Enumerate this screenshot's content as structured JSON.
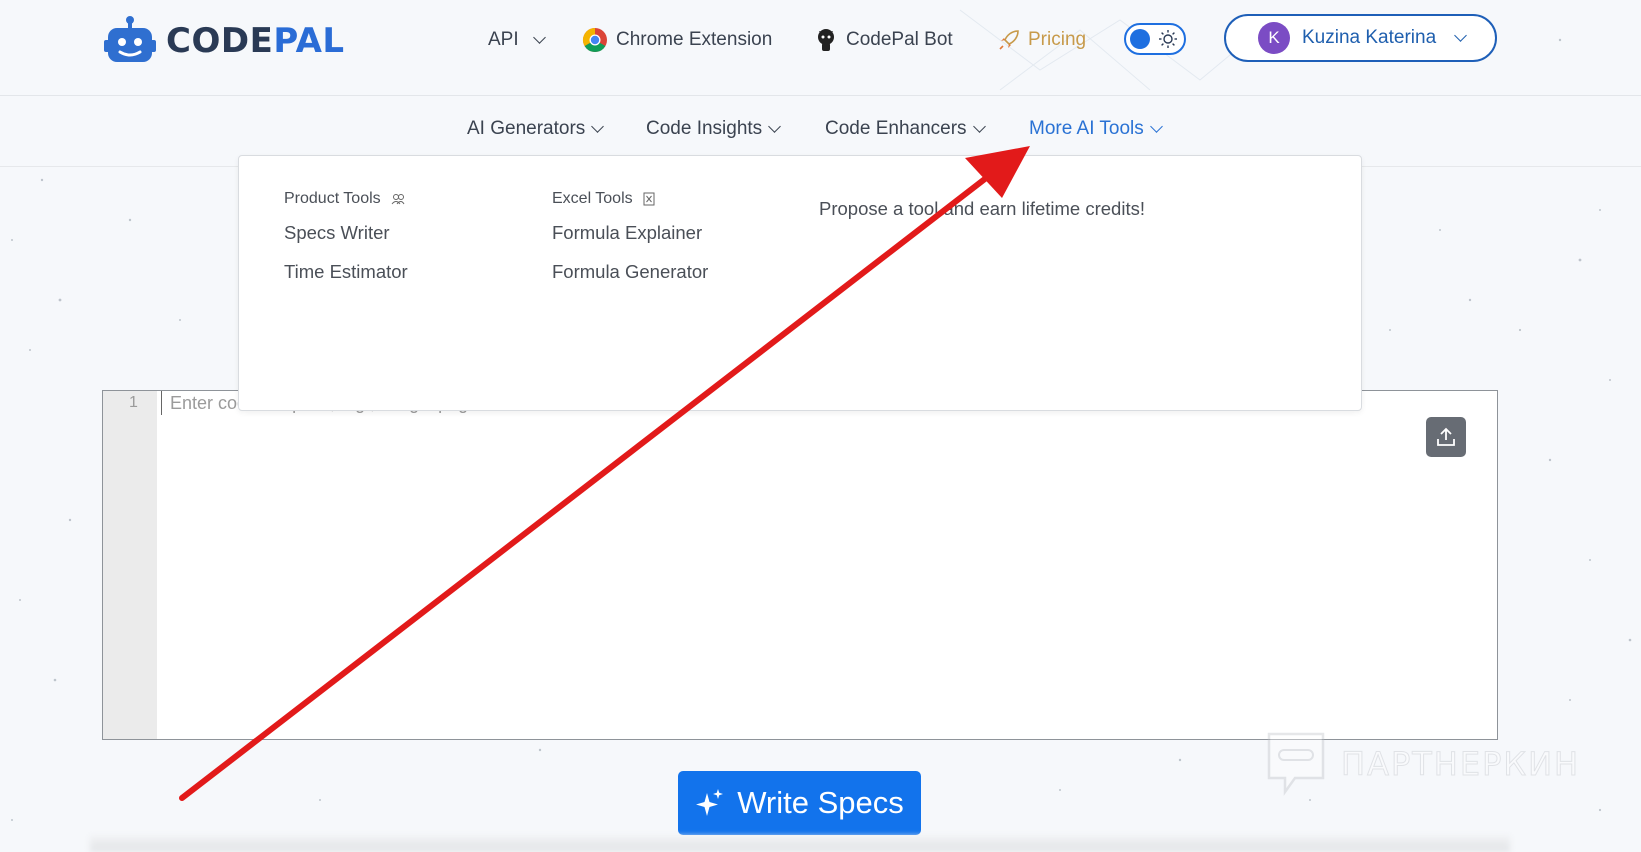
{
  "header": {
    "logo_part1": "CODE",
    "logo_part2": "PAL",
    "nav": {
      "api": "API",
      "chrome_extension": "Chrome Extension",
      "bot": "CodePal Bot",
      "pricing": "Pricing"
    },
    "user": {
      "initial": "K",
      "name": "Kuzina Katerina"
    }
  },
  "subnav": {
    "items": [
      "AI Generators",
      "Code Insights",
      "Code Enhancers",
      "More AI Tools"
    ],
    "active": "More AI Tools"
  },
  "dropdown": {
    "product_tools": {
      "title": "Product Tools",
      "links": [
        "Specs Writer",
        "Time Estimator"
      ]
    },
    "excel_tools": {
      "title": "Excel Tools",
      "links": [
        "Formula Explainer",
        "Formula Generator"
      ]
    },
    "cta": "Propose a tool and earn lifetime credits!"
  },
  "editor": {
    "line_number": "1",
    "placeholder": "Enter code or specs, e.g., a login page for users"
  },
  "action_button": "Write Specs",
  "watermark": "ПАРТНЕРКИН",
  "colors": {
    "accent": "#1273ec",
    "brand_dark": "#2a3a55",
    "brand_blue": "#2a6cd6",
    "pricing": "#c79a4a",
    "annotation_arrow": "#e21a1a"
  },
  "icons": {
    "logo": "robot-icon",
    "chrome": "chrome-icon",
    "bot": "github-icon",
    "pricing": "rocket-icon",
    "theme": "sun-icon",
    "product_tools": "users-icon",
    "excel_tools": "excel-icon",
    "upload": "upload-icon",
    "action": "sparkles-icon"
  }
}
